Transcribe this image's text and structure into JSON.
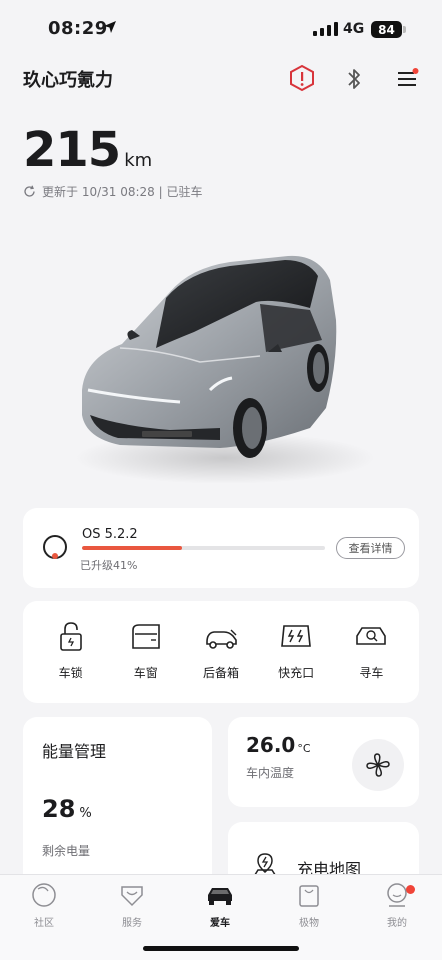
{
  "status_bar": {
    "time": "08:29",
    "network": "4G",
    "battery": "84"
  },
  "header": {
    "car_name": "玖心巧氪力"
  },
  "range": {
    "value": "215",
    "unit": "km",
    "update_text": "更新于 10/31 08:28 | 已驻车"
  },
  "os_update": {
    "title": "OS 5.2.2",
    "progress": 0.41,
    "status": "已升级41%",
    "button": "查看详情"
  },
  "controls": [
    {
      "label": "车锁",
      "icon": "lock-icon"
    },
    {
      "label": "车窗",
      "icon": "window-icon"
    },
    {
      "label": "后备箱",
      "icon": "trunk-icon"
    },
    {
      "label": "快充口",
      "icon": "charge-port-icon"
    },
    {
      "label": "寻车",
      "icon": "find-car-icon"
    }
  ],
  "energy": {
    "title": "能量管理",
    "value": "28",
    "unit": "%",
    "label": "剩余电量",
    "level": 0.28
  },
  "temperature": {
    "value": "26.0",
    "unit": "°C",
    "label": "车内温度"
  },
  "charging_map": {
    "label": "充电地图"
  },
  "tabs": [
    {
      "label": "社区",
      "icon": "community-icon"
    },
    {
      "label": "服务",
      "icon": "service-icon"
    },
    {
      "label": "爱车",
      "icon": "car-icon",
      "active": true
    },
    {
      "label": "极物",
      "icon": "shop-icon"
    },
    {
      "label": "我的",
      "icon": "profile-icon",
      "badge": true
    }
  ],
  "colors": {
    "accent": "#e9573f",
    "energy": "#2fd07a",
    "alert": "#d8343b"
  }
}
